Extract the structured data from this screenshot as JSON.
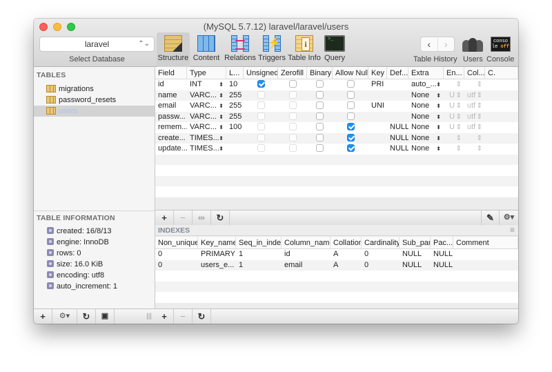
{
  "window": {
    "title": "(MySQL 5.7.12) laravel/laravel/users"
  },
  "toolbar": {
    "database_select": {
      "value": "laravel",
      "label": "Select Database"
    },
    "tools": [
      {
        "id": "structure",
        "label": "Structure",
        "icon": "structure-icon",
        "active": true
      },
      {
        "id": "content",
        "label": "Content",
        "icon": "content-icon",
        "active": false
      },
      {
        "id": "relations",
        "label": "Relations",
        "icon": "relations-icon",
        "active": false
      },
      {
        "id": "triggers",
        "label": "Triggers",
        "icon": "triggers-icon",
        "active": false
      },
      {
        "id": "table-info",
        "label": "Table Info",
        "icon": "info-icon",
        "active": false
      },
      {
        "id": "query",
        "label": "Query",
        "icon": "terminal-icon",
        "active": false
      }
    ],
    "table_history": {
      "label": "Table History",
      "back": "‹",
      "forward": "›"
    },
    "users": {
      "label": "Users"
    },
    "console": {
      "label": "Console",
      "icon_text_top": "conso",
      "icon_text_le": "le ",
      "icon_text_off": "off"
    }
  },
  "sidebar": {
    "tables_header": "TABLES",
    "tables": [
      {
        "name": "migrations",
        "selected": false
      },
      {
        "name": "password_resets",
        "selected": false
      },
      {
        "name": "users",
        "selected": true
      }
    ],
    "info_header": "TABLE INFORMATION",
    "info": [
      "created: 16/8/13",
      "engine: InnoDB",
      "rows: 0",
      "size: 16.0 KiB",
      "encoding: utf8",
      "auto_increment: 1"
    ],
    "bottom_buttons": {
      "add": "+",
      "gear": "⚙▾",
      "refresh": "↻",
      "toggle": "▣",
      "splitter": "|||"
    }
  },
  "structure": {
    "columns": [
      "Field",
      "Type",
      "L...",
      "Unsigned",
      "Zerofill",
      "Binary",
      "Allow Null",
      "Key",
      "Def...",
      "Extra",
      "En...",
      "Col...",
      "C."
    ],
    "rows": [
      {
        "field": "id",
        "type": "INT",
        "length": "10",
        "unsigned": true,
        "zerofill": false,
        "binary": false,
        "allow_null": false,
        "key": "PRI",
        "default": "",
        "extra": "auto_...",
        "encoding": "",
        "collation": ""
      },
      {
        "field": "name",
        "type": "VARC...",
        "length": "255",
        "unsigned": false,
        "zerofill": false,
        "binary": false,
        "allow_null": false,
        "key": "",
        "default": "",
        "extra": "None",
        "encoding": "U",
        "collation": "utf"
      },
      {
        "field": "email",
        "type": "VARC...",
        "length": "255",
        "unsigned": false,
        "zerofill": false,
        "binary": false,
        "allow_null": false,
        "key": "UNI",
        "default": "",
        "extra": "None",
        "encoding": "U",
        "collation": "utf"
      },
      {
        "field": "passw...",
        "type": "VARC...",
        "length": "255",
        "unsigned": false,
        "zerofill": false,
        "binary": false,
        "allow_null": false,
        "key": "",
        "default": "",
        "extra": "None",
        "encoding": "U",
        "collation": "utf"
      },
      {
        "field": "remem...",
        "type": "VARC...",
        "length": "100",
        "unsigned": false,
        "zerofill": false,
        "binary": false,
        "allow_null": true,
        "key": "",
        "default": "NULL",
        "extra": "None",
        "encoding": "U",
        "collation": "utf"
      },
      {
        "field": "create...",
        "type": "TIMES...",
        "length": "",
        "unsigned": false,
        "zerofill": false,
        "binary": false,
        "allow_null": true,
        "key": "",
        "default": "NULL",
        "extra": "None",
        "encoding": "",
        "collation": ""
      },
      {
        "field": "update...",
        "type": "TIMES...",
        "length": "",
        "unsigned": false,
        "zerofill": false,
        "binary": false,
        "allow_null": true,
        "key": "",
        "default": "NULL",
        "extra": "None",
        "encoding": "",
        "collation": ""
      }
    ],
    "bottom_buttons": {
      "add": "+",
      "remove": "−",
      "duplicate": "⇹",
      "refresh": "↻",
      "edit": "✎",
      "gear": "⚙▾"
    }
  },
  "indexes": {
    "header": "INDEXES",
    "columns": [
      "Non_unique",
      "Key_name",
      "Seq_in_index",
      "Column_name",
      "Collation",
      "Cardinality",
      "Sub_part",
      "Pac...",
      "Comment"
    ],
    "rows": [
      [
        "0",
        "PRIMARY",
        "1",
        "id",
        "A",
        "0",
        "NULL",
        "NULL",
        ""
      ],
      [
        "0",
        "users_e...",
        "1",
        "email",
        "A",
        "0",
        "NULL",
        "NULL",
        ""
      ]
    ],
    "bottom_buttons": {
      "add": "+",
      "remove": "−",
      "refresh": "↻"
    }
  }
}
